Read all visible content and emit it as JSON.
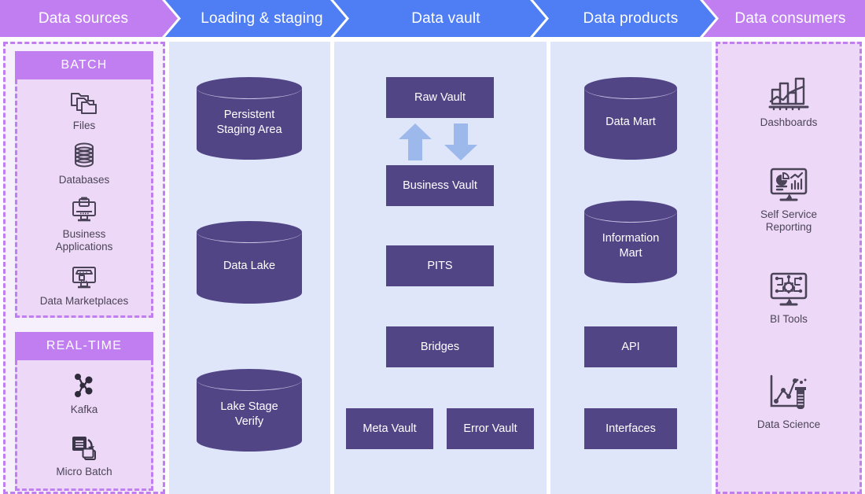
{
  "header": {
    "stages": [
      {
        "label": "Data sources",
        "color": "#c07ef0"
      },
      {
        "label": "Loading & staging",
        "color": "#4f7df3"
      },
      {
        "label": "Data vault",
        "color": "#4f7df3"
      },
      {
        "label": "Data products",
        "color": "#4f7df3"
      },
      {
        "label": "Data consumers",
        "color": "#c07ef0"
      }
    ]
  },
  "colors": {
    "accent_purple": "#c07ef0",
    "accent_blue": "#4f7df3",
    "node_fill": "#514586",
    "panel_blue": "#e0e6fa",
    "panel_purple": "#eed8f7",
    "arrow": "#9db8ea",
    "icon_stroke": "#4b4458"
  },
  "data_sources": {
    "batch": {
      "title": "BATCH",
      "items": [
        {
          "label": "Files",
          "icon": "files-icon"
        },
        {
          "label": "Databases",
          "icon": "databases-icon"
        },
        {
          "label": "Business\nApplications",
          "icon": "business-applications-icon"
        },
        {
          "label": "Data Marketplaces",
          "icon": "data-marketplaces-icon"
        }
      ]
    },
    "realtime": {
      "title": "REAL-TIME",
      "items": [
        {
          "label": "Kafka",
          "icon": "kafka-icon"
        },
        {
          "label": "Micro Batch",
          "icon": "micro-batch-icon"
        }
      ]
    }
  },
  "loading_staging": {
    "nodes": [
      {
        "label": "Persistent\nStaging Area",
        "shape": "cylinder"
      },
      {
        "label": "Data Lake",
        "shape": "cylinder"
      },
      {
        "label": "Lake Stage\nVerify",
        "shape": "cylinder"
      }
    ]
  },
  "data_vault": {
    "nodes": [
      {
        "label": "Raw Vault",
        "shape": "box"
      },
      {
        "label": "Business Vault",
        "shape": "box"
      },
      {
        "label": "PITS",
        "shape": "box"
      },
      {
        "label": "Bridges",
        "shape": "box"
      },
      {
        "label": "Meta Vault",
        "shape": "box"
      },
      {
        "label": "Error Vault",
        "shape": "box"
      }
    ],
    "arrows": [
      {
        "name": "arrow-up",
        "direction": "up"
      },
      {
        "name": "arrow-down",
        "direction": "down"
      }
    ]
  },
  "data_products": {
    "nodes": [
      {
        "label": "Data Mart",
        "shape": "cylinder"
      },
      {
        "label": "Information\nMart",
        "shape": "cylinder"
      },
      {
        "label": "API",
        "shape": "box"
      },
      {
        "label": "Interfaces",
        "shape": "box"
      }
    ]
  },
  "data_consumers": {
    "items": [
      {
        "label": "Dashboards",
        "icon": "bar-chart-icon"
      },
      {
        "label": "Self Service\nReporting",
        "icon": "monitor-report-icon"
      },
      {
        "label": "BI Tools",
        "icon": "monitor-gear-icon"
      },
      {
        "label": "Data Science",
        "icon": "science-chart-icon"
      }
    ]
  }
}
